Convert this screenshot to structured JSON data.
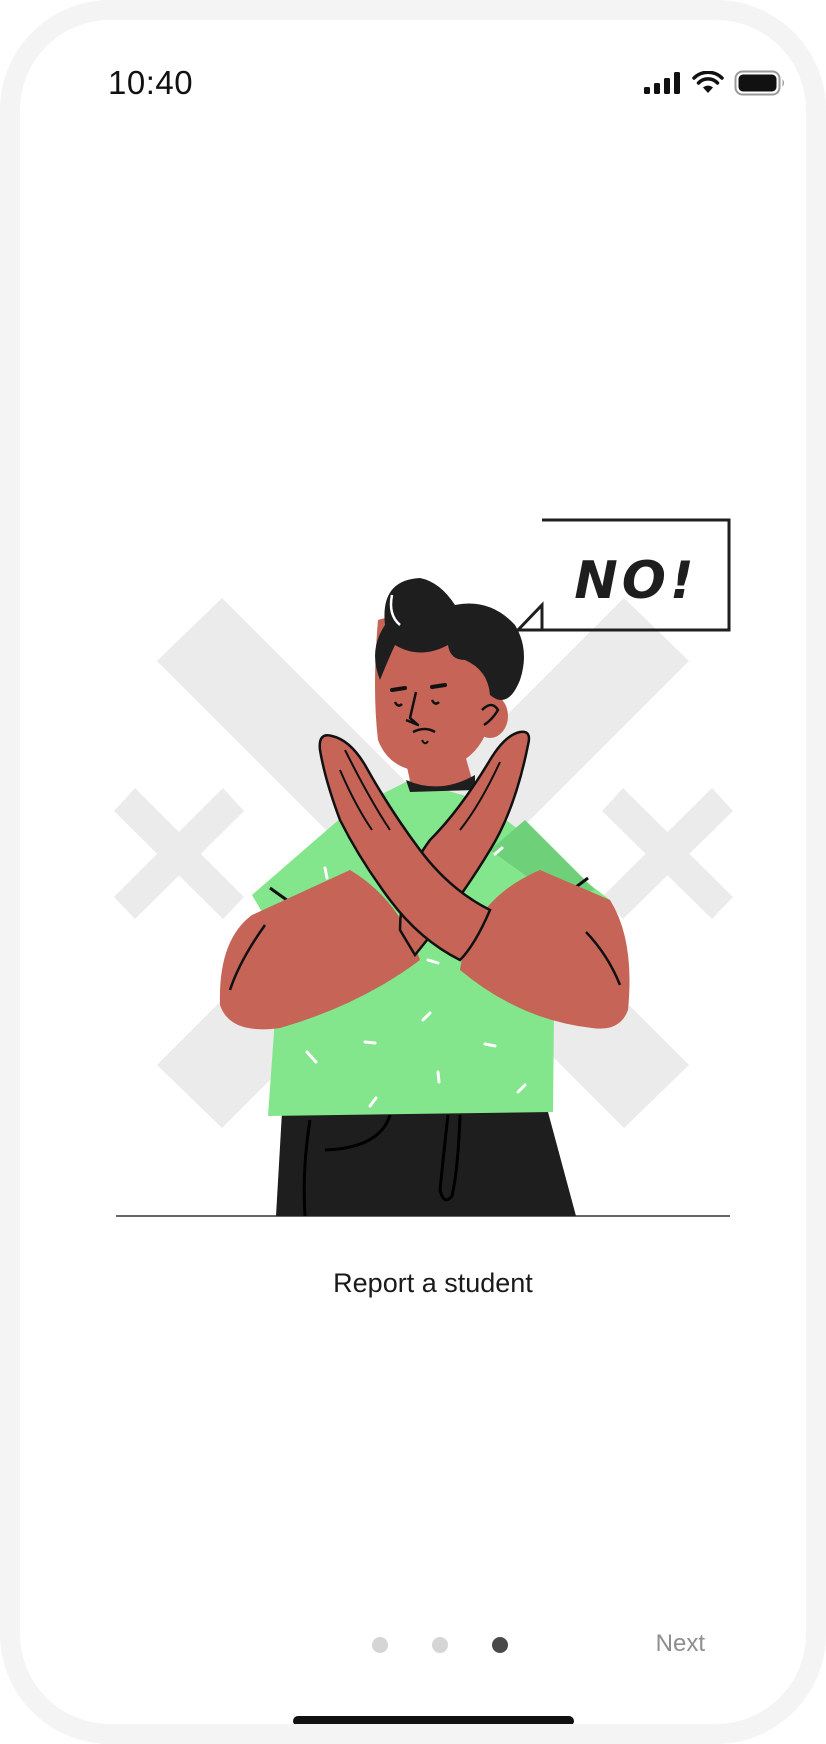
{
  "status_bar": {
    "time": "10:40",
    "icons": [
      "cellular-signal-icon",
      "wifi-icon",
      "battery-icon"
    ]
  },
  "illustration": {
    "speech_bubble_text": "NO!",
    "colors": {
      "shirt": "#83e58c",
      "skin": "#c56457",
      "hair": "#1e1e1e",
      "background_cross": "#ebebeb"
    }
  },
  "onboarding": {
    "caption": "Report a student",
    "pages_total": 3,
    "current_page": 3,
    "next_label": "Next"
  }
}
